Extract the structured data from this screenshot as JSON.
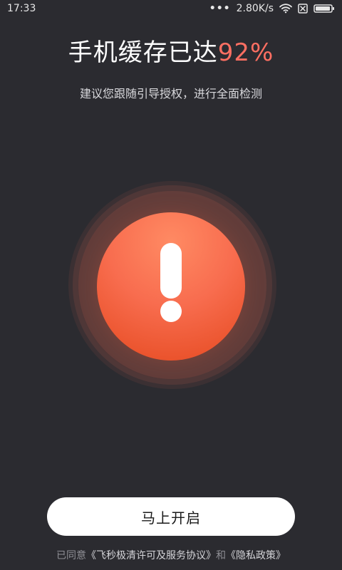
{
  "status_bar": {
    "time": "17:33",
    "network_speed": "2.80K/s",
    "icons": [
      "more-icon",
      "wifi-icon",
      "sim-icon",
      "battery-icon"
    ]
  },
  "header": {
    "title_prefix": "手机缓存已达",
    "title_percent": "92%",
    "subtitle": "建议您跟随引导授权，进行全面检测"
  },
  "alert": {
    "icon": "alert-icon",
    "colors": {
      "primary": "#f86d4f",
      "accent": "#ff6f62"
    }
  },
  "actions": {
    "primary_button_label": "马上开启"
  },
  "footer": {
    "agreement_prefix": "已同意",
    "agreement_link_1": "《飞秒极清许可及服务协议》",
    "agreement_joiner": "和",
    "agreement_link_2": "《隐私政策》"
  }
}
